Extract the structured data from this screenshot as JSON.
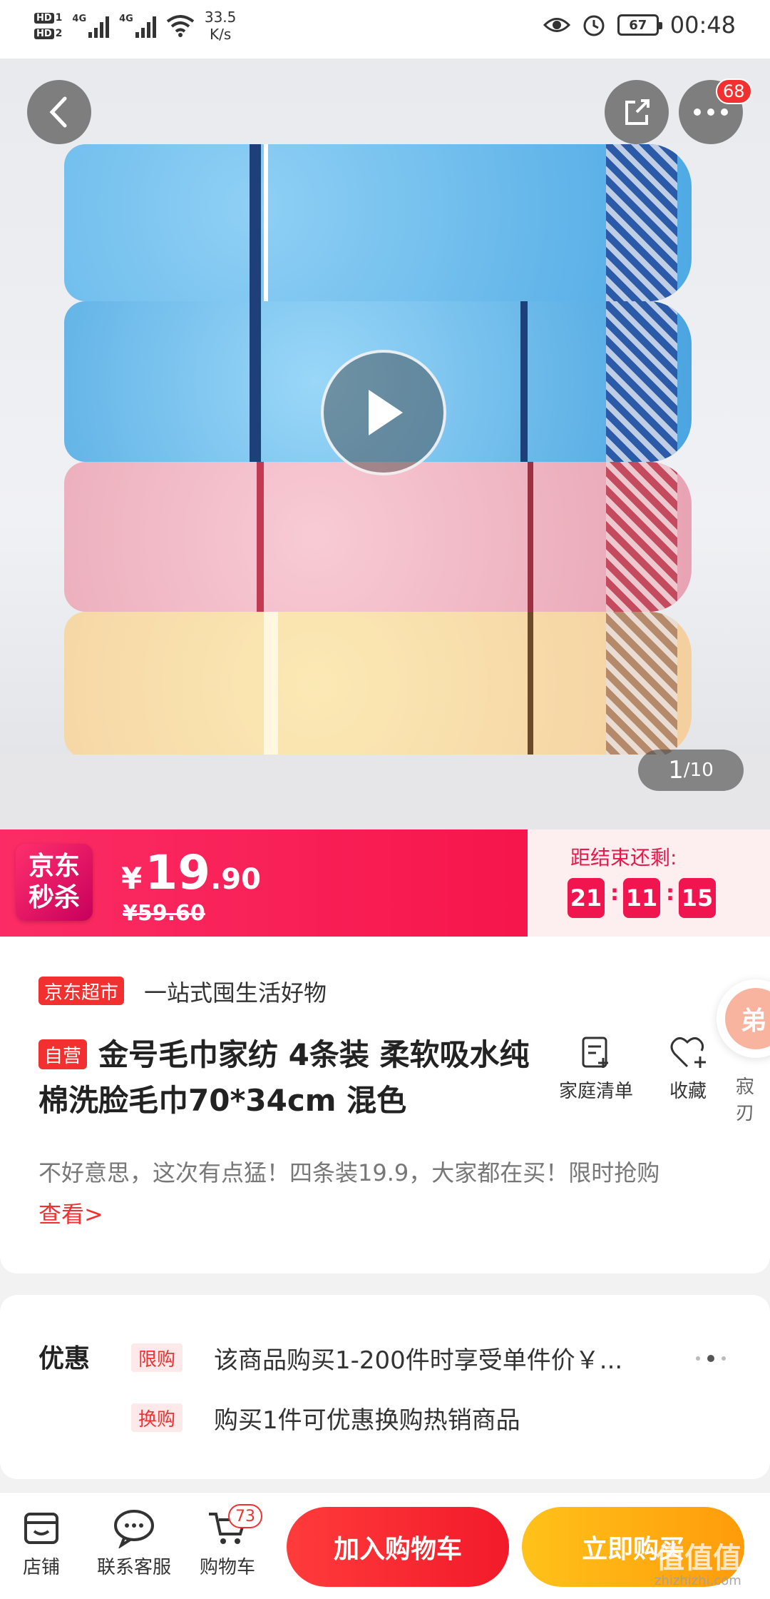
{
  "status_bar": {
    "hd1": "HD",
    "hd1_num": "1",
    "hd2": "HD",
    "hd2_num": "2",
    "net1": "4G",
    "net2": "4G",
    "speed_value": "33.5",
    "speed_unit": "K/s",
    "battery": "67",
    "time": "00:48"
  },
  "hero": {
    "more_badge": "68",
    "image_index": "1",
    "image_total": "/10"
  },
  "flash_sale": {
    "logo_line1": "京东",
    "logo_line2": "秒杀",
    "currency": "¥",
    "price_int": "19",
    "price_dec": ".90",
    "original_price": "¥59.60",
    "countdown_label": "距结束还剩:",
    "hours": "21",
    "minutes": "11",
    "seconds": "15",
    "colon": ":"
  },
  "product": {
    "market_tag": "京东超市",
    "market_slogan": "一站式囤生活好物",
    "self_tag": "自营",
    "title": "金号毛巾家纺 4条装 柔软吸水纯棉洗脸毛巾70*34cm 混色",
    "family_list_label": "家庭清单",
    "favorite_label": "收藏",
    "floating_chip": "弟",
    "floating_text": "寂刃",
    "promo_text": "不好意思，这次有点猛！四条装19.9，大家都在买！限时抢购",
    "see_more": "查看>"
  },
  "coupon": {
    "title": "优惠",
    "chip1": "限购",
    "line1": "该商品购买1-200件时享受单件价￥...",
    "chip2": "换购",
    "line2": "购买1件可优惠换购热销商品"
  },
  "bottom_bar": {
    "shop_label": "店铺",
    "service_label": "联系客服",
    "cart_label": "购物车",
    "cart_badge": "73",
    "add_to_cart": "加入购物车",
    "buy_now": "立即购买"
  },
  "watermark": {
    "text": "值值值",
    "sub": "zhizhizhi.com"
  },
  "colors": {
    "accent_red": "#f23030",
    "flash_pink": "#f6154a",
    "buy_orange": "#ff9b0a"
  }
}
